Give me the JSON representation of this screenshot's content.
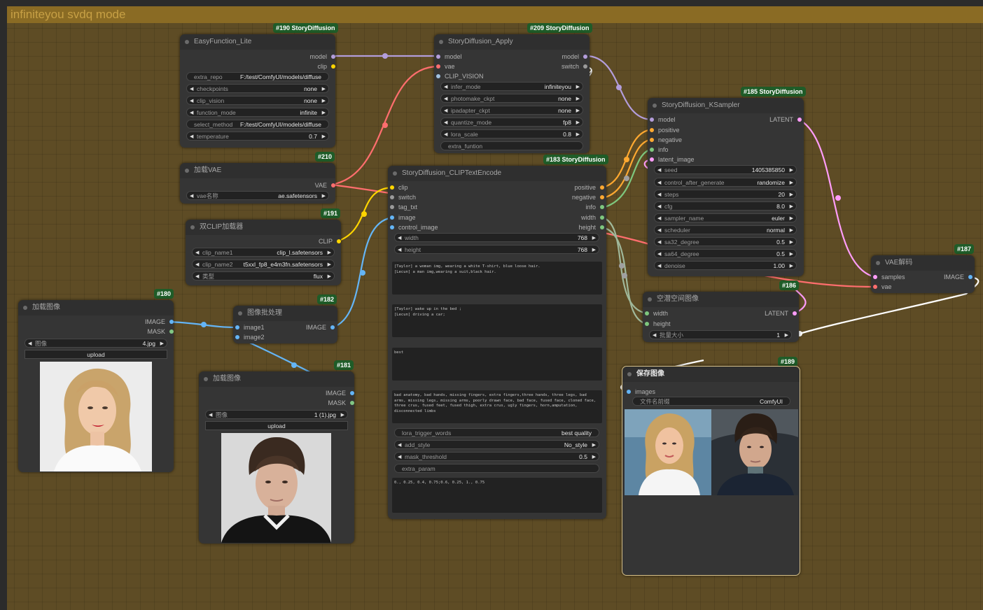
{
  "group": {
    "title": "infiniteyou svdq mode"
  },
  "nodes": {
    "easyfunction": {
      "badge": "#190 StoryDiffusion",
      "title": "EasyFunction_Lite",
      "outputs": [
        "model",
        "clip"
      ],
      "widgets": [
        {
          "label": "extra_repo",
          "value": "F:/test/ComfyUI/models/diffuse"
        },
        {
          "label": "checkpoints",
          "value": "none"
        },
        {
          "label": "clip_vision",
          "value": "none"
        },
        {
          "label": "function_mode",
          "value": "infinite"
        },
        {
          "label": "select_method",
          "value": "F:/test/ComfyUI/models/diffuse"
        },
        {
          "label": "temperature",
          "value": "0.7"
        }
      ]
    },
    "loadvae": {
      "badge": "#210",
      "title": "加载VAE",
      "outputs": [
        "VAE"
      ],
      "widgets": [
        {
          "label": "vae名称",
          "value": "ae.safetensors"
        }
      ]
    },
    "dualclip": {
      "badge": "#191",
      "title": "双CLIP加载器",
      "outputs": [
        "CLIP"
      ],
      "widgets": [
        {
          "label": "clip_name1",
          "value": "clip_l.safetensors"
        },
        {
          "label": "clip_name2",
          "value": "t5xxl_fp8_e4m3fn.safetensors"
        },
        {
          "label": "类型",
          "value": "flux"
        }
      ]
    },
    "loadimage1": {
      "badge": "#180",
      "title": "加载图像",
      "outputs": [
        "IMAGE",
        "MASK"
      ],
      "widgets": [
        {
          "label": "图像",
          "value": "4.jpg"
        }
      ],
      "upload": "upload"
    },
    "imagebatch": {
      "badge": "#182",
      "title": "图像批处理",
      "inputs": [
        "image1",
        "image2"
      ],
      "outputs": [
        "IMAGE"
      ]
    },
    "loadimage2": {
      "badge": "#181",
      "title": "加载图像",
      "outputs": [
        "IMAGE",
        "MASK"
      ],
      "widgets": [
        {
          "label": "图像",
          "value": "1 (1).jpg"
        }
      ],
      "upload": "upload"
    },
    "apply": {
      "badge": "#209 StoryDiffusion",
      "title": "StoryDiffusion_Apply",
      "inputs": [
        "model",
        "vae",
        "CLIP_VISION"
      ],
      "outputs": [
        "model",
        "switch"
      ],
      "widgets": [
        {
          "label": "infer_mode",
          "value": "infiniteyou"
        },
        {
          "label": "photomake_ckpt",
          "value": "none"
        },
        {
          "label": "ipadapter_ckpt",
          "value": "none"
        },
        {
          "label": "quantize_mode",
          "value": "fp8"
        },
        {
          "label": "lora_scale",
          "value": "0.8"
        },
        {
          "label": "extra_funtion",
          "value": ""
        }
      ]
    },
    "textencode": {
      "badge": "#183 StoryDiffusion",
      "title": "StoryDiffusion_CLIPTextEncode",
      "inputs": [
        "clip",
        "switch",
        "tag_txt",
        "image",
        "control_image"
      ],
      "outputs": [
        "positive",
        "negative",
        "info",
        "width",
        "height"
      ],
      "widgets": [
        {
          "label": "width",
          "value": "768"
        },
        {
          "label": "height",
          "value": "768"
        }
      ],
      "text1": "[Taylor] a woman img, wearing a white T-shirt, blue loose hair.\n[Lecun] a man img,wearing a suit,black hair.",
      "text2": "[Taylor] wake up in the bed ;\n[Lecun] driving a car;",
      "text3": "best",
      "text4": "bad anatomy, bad hands, missing fingers, extra fingers,three hands, three legs, bad arms, missing legs, missing arms, poorly drawn face, bad face, fused face, cloned face, three crus, fused feet, fused thigh, extra crus, ugly fingers, horn,amputation, disconnected limbs",
      "widgets2": [
        {
          "label": "lora_trigger_words",
          "value": "best quality"
        },
        {
          "label": "add_style",
          "value": "No_style"
        },
        {
          "label": "mask_threshold",
          "value": "0.5"
        },
        {
          "label": "extra_param",
          "value": ""
        }
      ],
      "text5": "0., 0.25, 0.4, 0.75;0.6, 0.25, 1., 0.75"
    },
    "ksampler": {
      "badge": "#185 StoryDiffusion",
      "title": "StoryDiffusion_KSampler",
      "inputs": [
        "model",
        "positive",
        "negative",
        "info",
        "latent_image"
      ],
      "outputs": [
        "LATENT"
      ],
      "widgets": [
        {
          "label": "seed",
          "value": "1405385850"
        },
        {
          "label": "control_after_generate",
          "value": "randomize"
        },
        {
          "label": "steps",
          "value": "20"
        },
        {
          "label": "cfg",
          "value": "8.0"
        },
        {
          "label": "sampler_name",
          "value": "euler"
        },
        {
          "label": "scheduler",
          "value": "normal"
        },
        {
          "label": "sa32_degree",
          "value": "0.5"
        },
        {
          "label": "sa64_degree",
          "value": "0.5"
        },
        {
          "label": "denoise",
          "value": "1.00"
        }
      ]
    },
    "vaedecode": {
      "badge": "#187",
      "title": "VAE解码",
      "inputs": [
        "samples",
        "vae"
      ],
      "outputs": [
        "IMAGE"
      ]
    },
    "emptylatent": {
      "badge": "#186",
      "title": "空潜空间图像",
      "inputs": [
        "width",
        "height"
      ],
      "outputs": [
        "LATENT"
      ],
      "widgets": [
        {
          "label": "批量大小",
          "value": "1"
        }
      ]
    },
    "saveimage": {
      "badge": "#189",
      "title": "保存图像",
      "inputs": [
        "images"
      ],
      "widgets": [
        {
          "label": "文件名前缀",
          "value": "ComfyUI"
        }
      ]
    }
  },
  "colors": {
    "model": "#b39ddb",
    "clip": "#ffd500",
    "vae": "#ff6e6e",
    "image": "#64b5f6",
    "mask": "#81c784",
    "latent": "#ff9cf9",
    "conditioning": "#ffa931",
    "int": "#7ec77e",
    "badge": "#1f5c28",
    "group": "#8a6b24"
  }
}
